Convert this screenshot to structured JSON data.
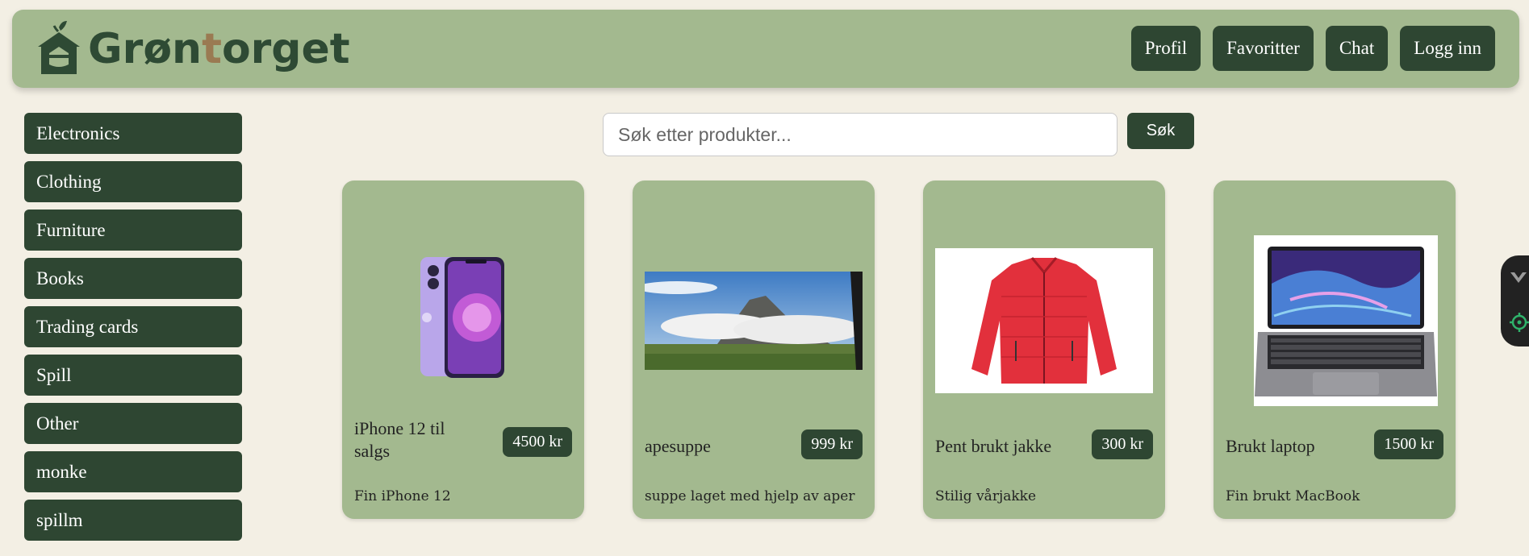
{
  "header": {
    "logo_text_a": "Grøn",
    "logo_text_b": "t",
    "logo_text_c": "orget",
    "nav": [
      "Profil",
      "Favoritter",
      "Chat",
      "Logg inn"
    ]
  },
  "sidebar": {
    "categories": [
      "Electronics",
      "Clothing",
      "Furniture",
      "Books",
      "Trading cards",
      "Spill",
      "Other",
      "monke",
      "spillm"
    ]
  },
  "search": {
    "placeholder": "Søk etter produkter...",
    "button_label": "Søk"
  },
  "products": [
    {
      "title": "iPhone 12 til salgs",
      "price": "4500 kr",
      "description": "Fin iPhone 12"
    },
    {
      "title": "apesuppe",
      "price": "999 kr",
      "description": "suppe laget med hjelp av aper"
    },
    {
      "title": "Pent brukt jakke",
      "price": "300 kr",
      "description": "Stilig vårjakke"
    },
    {
      "title": "Brukt laptop",
      "price": "1500 kr",
      "description": "Fin brukt MacBook"
    }
  ],
  "colors": {
    "background": "#f3efe4",
    "header": "#a3b98f",
    "dark_green": "#2e4632",
    "card": "#a3b98f"
  }
}
